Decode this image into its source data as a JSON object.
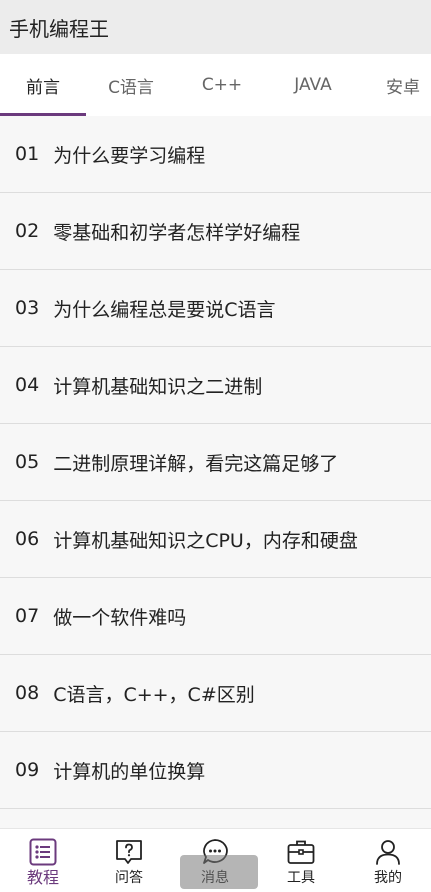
{
  "app": {
    "title": "手机编程王"
  },
  "tabs": [
    {
      "label": "前言",
      "active": true
    },
    {
      "label": "C语言",
      "active": false
    },
    {
      "label": "C++",
      "active": false
    },
    {
      "label": "JAVA",
      "active": false
    },
    {
      "label": "安卓",
      "active": false
    }
  ],
  "articles": [
    {
      "num": "01",
      "title": "为什么要学习编程"
    },
    {
      "num": "02",
      "title": "零基础和初学者怎样学好编程"
    },
    {
      "num": "03",
      "title": "为什么编程总是要说C语言"
    },
    {
      "num": "04",
      "title": "计算机基础知识之二进制"
    },
    {
      "num": "05",
      "title": "二进制原理详解，看完这篇足够了"
    },
    {
      "num": "06",
      "title": "计算机基础知识之CPU，内存和硬盘"
    },
    {
      "num": "07",
      "title": "做一个软件难吗"
    },
    {
      "num": "08",
      "title": "C语言，C++，C#区别"
    },
    {
      "num": "09",
      "title": "计算机的单位换算"
    }
  ],
  "bottom_nav": [
    {
      "label": "教程",
      "icon": "list-icon",
      "active": true
    },
    {
      "label": "问答",
      "icon": "question-bubble-icon",
      "active": false
    },
    {
      "label": "消息",
      "icon": "chat-bubble-icon",
      "active": false
    },
    {
      "label": "工具",
      "icon": "toolbox-icon",
      "active": false
    },
    {
      "label": "我的",
      "icon": "person-icon",
      "active": false
    }
  ],
  "colors": {
    "accent": "#6b3a7d",
    "app_bar": "#ececec",
    "list_bg": "#f7f7f7",
    "divider": "#dddddd"
  }
}
